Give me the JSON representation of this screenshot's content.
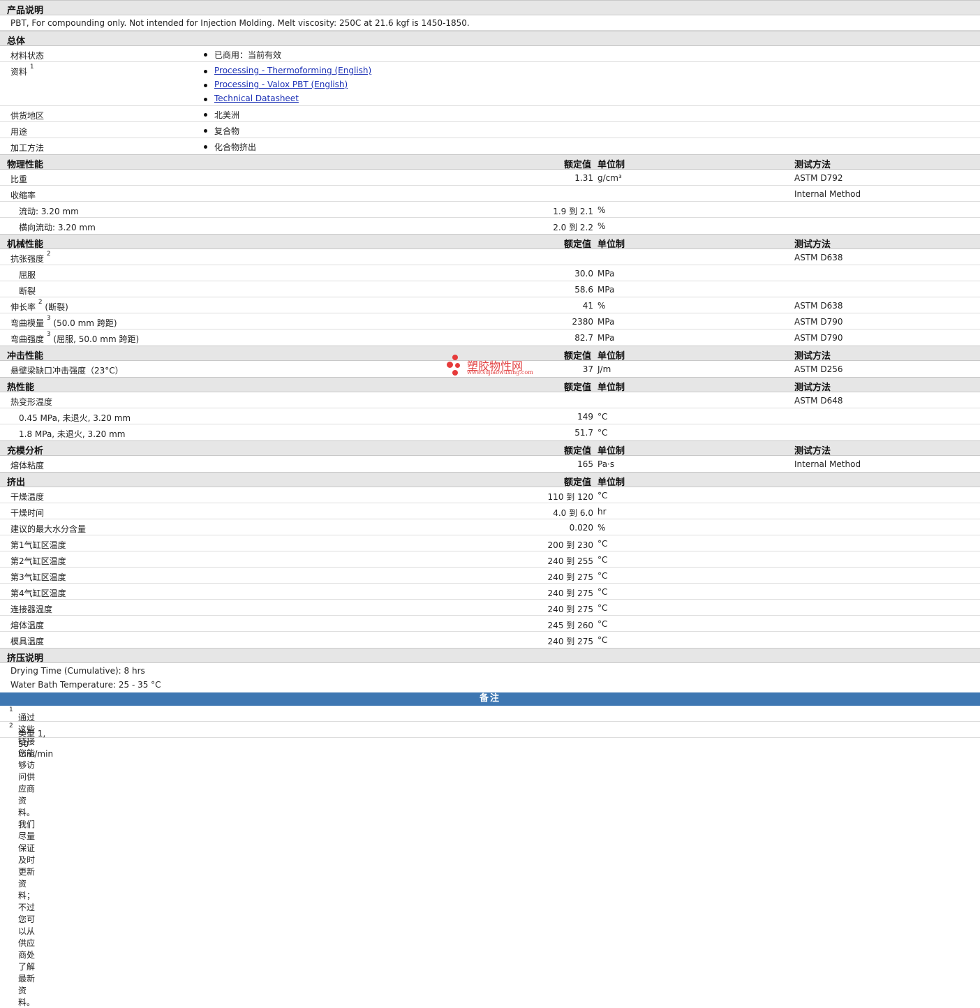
{
  "product_desc": {
    "title": "产品说明",
    "text": "PBT, For compounding only. Not intended for Injection Molding. Melt viscosity: 250C at 21.6 kgf is 1450-1850."
  },
  "general": {
    "title": "总体",
    "status_label": "材料状态",
    "status_value": "已商用：当前有效",
    "docs_label": "资料",
    "docs_sup": "1",
    "docs": [
      "Processing - Thermoforming (English)",
      "Processing - Valox PBT (English)",
      "Technical Datasheet"
    ],
    "region_label": "供货地区",
    "region_value": "北美洲",
    "use_label": "用途",
    "use_value": "复合物",
    "method_label": "加工方法",
    "method_value": "化合物挤出"
  },
  "col": {
    "nominal": "额定值",
    "unit": "单位制",
    "test": "测试方法"
  },
  "physical": {
    "title": "物理性能",
    "rows": [
      {
        "label": "比重",
        "value": "1.31",
        "unit": "g/cm³",
        "test": "ASTM D792"
      },
      {
        "label": "收缩率",
        "value": "",
        "unit": "",
        "test": "Internal Method"
      },
      {
        "label": "流动: 3.20 mm",
        "value": "1.9 到  2.1",
        "unit": "%",
        "test": ""
      },
      {
        "label": "横向流动: 3.20 mm",
        "value": "2.0 到  2.2",
        "unit": "%",
        "test": ""
      }
    ]
  },
  "mechanical": {
    "title": "机械性能",
    "tensile_label": "抗张强度",
    "tensile_sup": "2",
    "tensile_test": "ASTM D638",
    "yield_label": "屈服",
    "yield_value": "30.0",
    "yield_unit": "MPa",
    "break_label": "断裂",
    "break_value": "58.6",
    "break_unit": "MPa",
    "elong_label": "伸长率",
    "elong_sup": "2",
    "elong_suffix": "(断裂)",
    "elong_value": "41",
    "elong_unit": "%",
    "elong_test": "ASTM D638",
    "flexmod_label": "弯曲模量",
    "flexmod_sup": "3",
    "flexmod_suffix": "(50.0 mm 跨距)",
    "flexmod_value": "2380",
    "flexmod_unit": "MPa",
    "flexmod_test": "ASTM D790",
    "flexstr_label": "弯曲强度",
    "flexstr_sup": "3",
    "flexstr_suffix": "(屈服, 50.0 mm 跨距)",
    "flexstr_value": "82.7",
    "flexstr_unit": "MPa",
    "flexstr_test": "ASTM D790"
  },
  "impact": {
    "title": "冲击性能",
    "label": "悬壁梁缺口冲击强度（23°C）",
    "value": "37",
    "unit": "J/m",
    "test": "ASTM D256"
  },
  "thermal": {
    "title": "热性能",
    "rows": [
      {
        "label": "热变形温度",
        "value": "",
        "unit": "",
        "test": "ASTM D648"
      },
      {
        "label": "0.45 MPa, 未退火, 3.20 mm",
        "value": "149",
        "unit": "°C",
        "test": ""
      },
      {
        "label": "1.8 MPa, 未退火, 3.20 mm",
        "value": "51.7",
        "unit": "°C",
        "test": ""
      }
    ]
  },
  "fill": {
    "title": "充模分析",
    "label": "熔体粘度",
    "value": "165",
    "unit": "Pa·s",
    "test": "Internal Method"
  },
  "extrusion": {
    "title": "挤出",
    "rows": [
      {
        "label": "干燥温度",
        "value": "110 到  120",
        "unit": "°C"
      },
      {
        "label": "干燥时间",
        "value": "4.0 到  6.0",
        "unit": "hr"
      },
      {
        "label": "建议的最大水分含量",
        "value": "0.020",
        "unit": "%"
      },
      {
        "label": "第1气缸区温度",
        "value": "200 到  230",
        "unit": "°C"
      },
      {
        "label": "第2气缸区温度",
        "value": "240 到  255",
        "unit": "°C"
      },
      {
        "label": "第3气缸区温度",
        "value": "240 到  275",
        "unit": "°C"
      },
      {
        "label": "第4气缸区温度",
        "value": "240 到  275",
        "unit": "°C"
      },
      {
        "label": "连接器温度",
        "value": "240 到  275",
        "unit": "°C"
      },
      {
        "label": "熔体温度",
        "value": "245 到  260",
        "unit": "°C"
      },
      {
        "label": "模具温度",
        "value": "240 到  275",
        "unit": "°C"
      }
    ]
  },
  "extrusion_notes": {
    "title": "挤压说明",
    "line1": "Drying Time (Cumulative): 8 hrs",
    "line2": "Water Bath Temperature: 25 - 35 °C"
  },
  "remarks": {
    "title": "备注",
    "note1_sup": "1",
    "note1": "通过这些链接您能够访问供应商资料。我们尽量保证及时更新资料；不过您可以从供应商处了解最新资料。",
    "note2_sup": "2",
    "note2": "类型  1, 50 mm/min"
  },
  "watermark": {
    "name": "塑胶物性网",
    "url": "www.sujiaowuxing.com"
  }
}
